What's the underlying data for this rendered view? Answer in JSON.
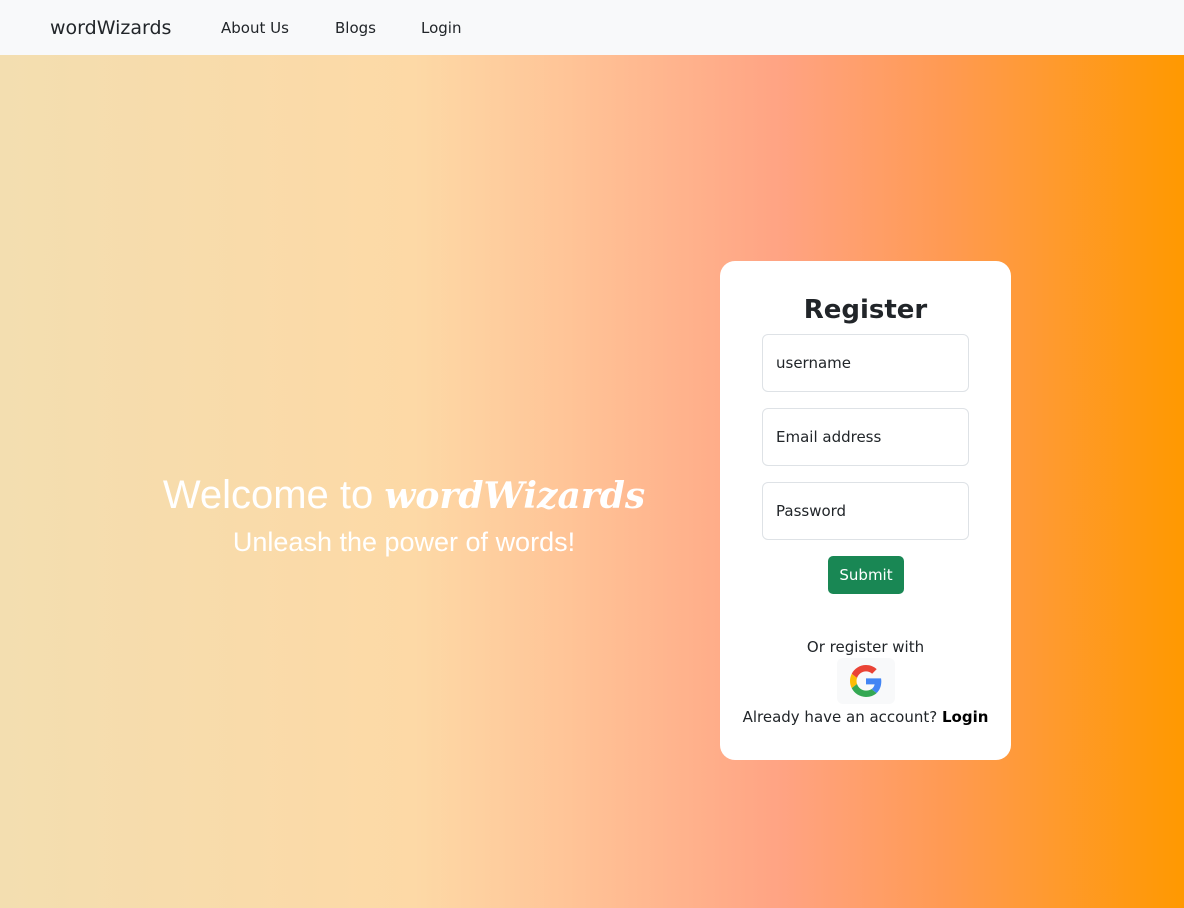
{
  "nav": {
    "brand": "wordWizards",
    "links": [
      "About Us",
      "Blogs",
      "Login"
    ]
  },
  "hero": {
    "welcome_prefix": "Welcome to",
    "welcome_brand": "wordWizards",
    "tagline": "Unleash the power of words!",
    "gradient_colors": [
      "#f3deb0",
      "#fdd9a6",
      "#ffa383",
      "#ff9900"
    ]
  },
  "register": {
    "title": "Register",
    "username_placeholder": "username",
    "email_placeholder": "Email address",
    "password_placeholder": "Password",
    "submit_label": "Submit",
    "or_register_text": "Or register with",
    "google_icon": "google-icon",
    "already_text": "Already have an account?",
    "login_link": "Login"
  },
  "colors": {
    "submit": "#198754",
    "navbar_bg": "#f8f9fa",
    "card_bg": "#ffffff"
  }
}
